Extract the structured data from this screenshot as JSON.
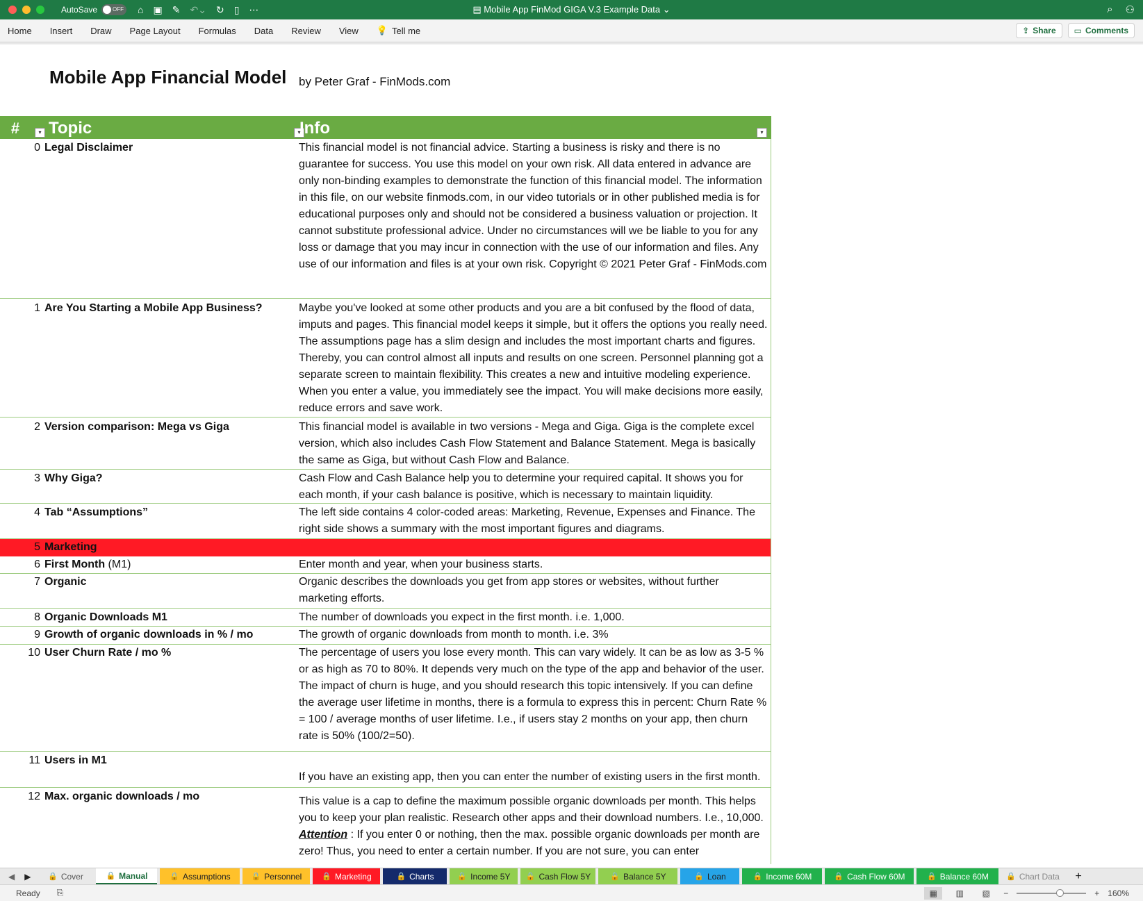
{
  "window": {
    "autosave_label": "AutoSave",
    "autosave_state": "OFF",
    "doc_title": "Mobile App FinMod GIGA V.3 Example Data"
  },
  "ribbon": {
    "tabs": [
      "Home",
      "Insert",
      "Draw",
      "Page Layout",
      "Formulas",
      "Data",
      "Review",
      "View"
    ],
    "tell_me": "Tell me",
    "share": "Share",
    "comments": "Comments"
  },
  "sheet": {
    "title": "Mobile App Financial Model",
    "subtitle": "by Peter Graf - FinMods.com",
    "headers": {
      "num": "#",
      "topic": "Topic",
      "info": "Info"
    },
    "rows": [
      {
        "num": "0",
        "topic": "Legal Disclaimer",
        "info": "This financial model is not financial advice. Starting a business is risky and there is no guarantee for success. You use this model on your own risk. All data entered in advance are only non-binding examples to demonstrate the function of this financial model. The information in this file, on our website finmods.com, in our video tutorials or in other published media is for educational purposes only and should not be considered a business valuation or projection. It cannot substitute professional advice. Under no circumstances will we be liable to you for any loss or damage that you may incur in connection with the use of our information and files. Any use of our information and files is at your own risk. Copyright © 2021 Peter Graf - FinMods.com"
      },
      {
        "num": "1",
        "topic": "Are You Starting a Mobile App Business?",
        "info": "Maybe you've looked at some other products and you are a bit confused by the flood of data, imputs and pages. This financial model keeps it simple, but it offers the options you really need. The assumptions page has a slim design and includes the most important charts and figures.   Thereby, you can control almost all inputs and results on one screen. Personnel planning got a separate screen to maintain flexibility. This creates a new and intuitive modeling experience. When you enter a value, you immediately see the impact. You will make decisions more easily, reduce errors and save work."
      },
      {
        "num": "2",
        "topic": "Version comparison: Mega vs Giga",
        "info": "This financial model is available in two versions - Mega and Giga. Giga is the complete excel version, which also includes Cash Flow Statement and Balance Statement. Mega is basically the same as Giga, but without Cash Flow and Balance."
      },
      {
        "num": "3",
        "topic": "Why Giga?",
        "info": "Cash Flow and Cash Balance help you to determine your required capital. It shows you for each month, if your cash balance is positive, which is necessary to maintain liquidity."
      },
      {
        "num": "4",
        "topic": "Tab “Assumptions”",
        "info": "The left side contains 4 color-coded areas: Marketing, Revenue, Expenses and Finance. The right side shows a summary with the most important figures and diagrams."
      },
      {
        "num": "5",
        "topic": "Marketing",
        "info": ""
      },
      {
        "num": "6",
        "topic": "First Month",
        "topic_suffix": " (M1)",
        "info": "Enter month and year, when your business starts."
      },
      {
        "num": "7",
        "topic": "Organic",
        "info": "Organic describes the downloads you get from app stores or websites, without further marketing efforts."
      },
      {
        "num": "8",
        "topic": "Organic Downloads M1",
        "info": "The number of downloads you expect in the first month. i.e. 1,000."
      },
      {
        "num": "9",
        "topic": "Growth of organic downloads in % / mo",
        "info": "The growth of organic downloads from month to month. i.e. 3%"
      },
      {
        "num": "10",
        "topic": "User Churn Rate / mo %",
        "info": "The percentage of users you lose every month. This can vary widely. It can be as low as 3-5 % or as high as 70 to 80%. It depends very much on the type of the app and behavior of the user. The impact of churn is huge, and you should research this topic intensively. If you can define the average user lifetime in months, there is a formula to express this in percent: Churn Rate % = 100 / average months of user lifetime. I.e., if users stay 2 months on your app, then churn rate is 50% (100/2=50)."
      },
      {
        "num": "11",
        "topic": "Users in M1",
        "info": "If you have an existing app, then you can enter the number of existing users in the first month."
      },
      {
        "num": "12",
        "topic": "Max. organic downloads / mo",
        "info_a": "This value is a cap to define the maximum possible organic downloads per month. This helps you to keep your plan realistic. Research other apps and their download numbers. I.e., 10,000. ",
        "info_att": "Attention",
        "info_b": " : If you enter 0 or nothing, then the max. possible organic downloads per month are zero! Thus, you need to enter a certain number. If you are not sure, you can enter"
      }
    ]
  },
  "sheet_tabs": [
    {
      "label": "Cover",
      "bg": "#e9e9e9",
      "color": "#555",
      "lock": true
    },
    {
      "label": "Manual",
      "bg": "#ffffff",
      "color": "#1f6f3f",
      "lock": true,
      "active": true
    },
    {
      "label": "Assumptions",
      "bg": "#ffc12a",
      "color": "#222",
      "lock": true
    },
    {
      "label": "Personnel",
      "bg": "#ffc12a",
      "color": "#222",
      "lock": true
    },
    {
      "label": "Marketing",
      "bg": "#ff1a25",
      "color": "#ffffff",
      "lock": true
    },
    {
      "label": "Charts",
      "bg": "#142a6b",
      "color": "#ffffff",
      "lock": true
    },
    {
      "label": "Income 5Y",
      "bg": "#92cf50",
      "color": "#222",
      "lock": true
    },
    {
      "label": "Cash Flow 5Y",
      "bg": "#92cf50",
      "color": "#222",
      "lock": true
    },
    {
      "label": "Balance 5Y",
      "bg": "#92cf50",
      "color": "#222",
      "lock": true
    },
    {
      "label": "Loan",
      "bg": "#26a4e8",
      "color": "#222",
      "lock": true
    },
    {
      "label": "Income 60M",
      "bg": "#22b14c",
      "color": "#ffffff",
      "lock": true
    },
    {
      "label": "Cash Flow 60M",
      "bg": "#22b14c",
      "color": "#ffffff",
      "lock": true
    },
    {
      "label": "Balance 60M",
      "bg": "#22b14c",
      "color": "#ffffff",
      "lock": true
    },
    {
      "label": "Chart Data",
      "bg": "#e9e9e9",
      "color": "#888",
      "lock": true
    }
  ],
  "status": {
    "ready": "Ready",
    "zoom": "160%"
  }
}
